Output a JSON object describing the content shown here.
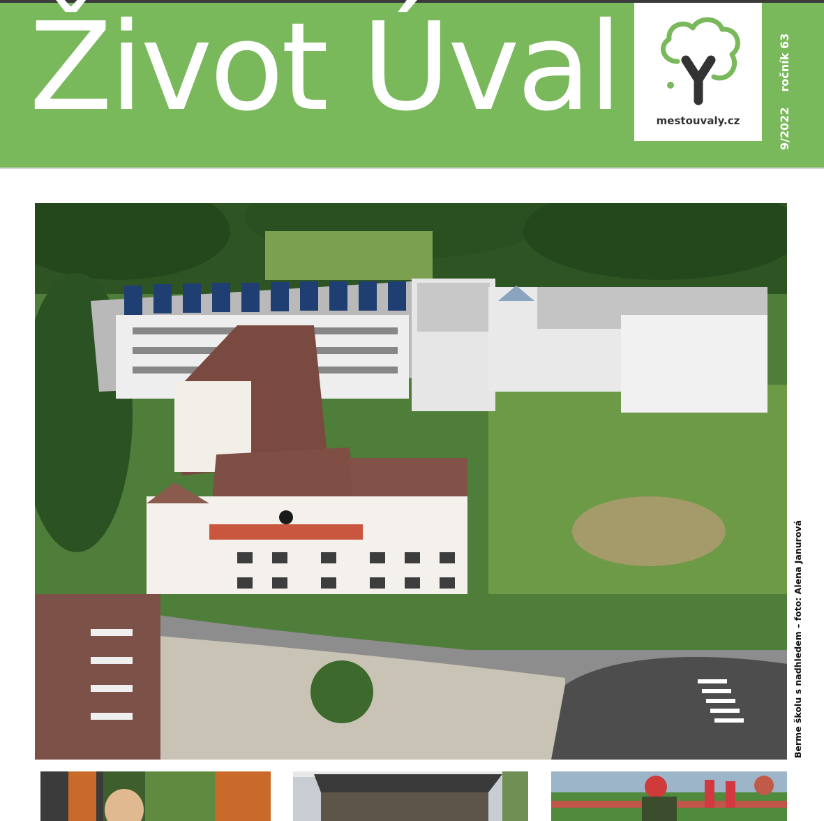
{
  "masthead": {
    "title": "Život Úval",
    "logo_url": "mestouvaly.cz",
    "issue": "9/2022",
    "volume": "ročník 63",
    "colors": {
      "brand_green": "#7ab85c",
      "logo_grey": "#333333"
    }
  },
  "cover_photo": {
    "alt_icon": "aerial-school-photo",
    "caption": "Berme školu s nadhledem – foto: Alena Janurová"
  },
  "thumbnails": [
    {
      "icon": "vehicle-interior-photo"
    },
    {
      "icon": "stage-tent-photo"
    },
    {
      "icon": "sports-race-photo"
    }
  ]
}
